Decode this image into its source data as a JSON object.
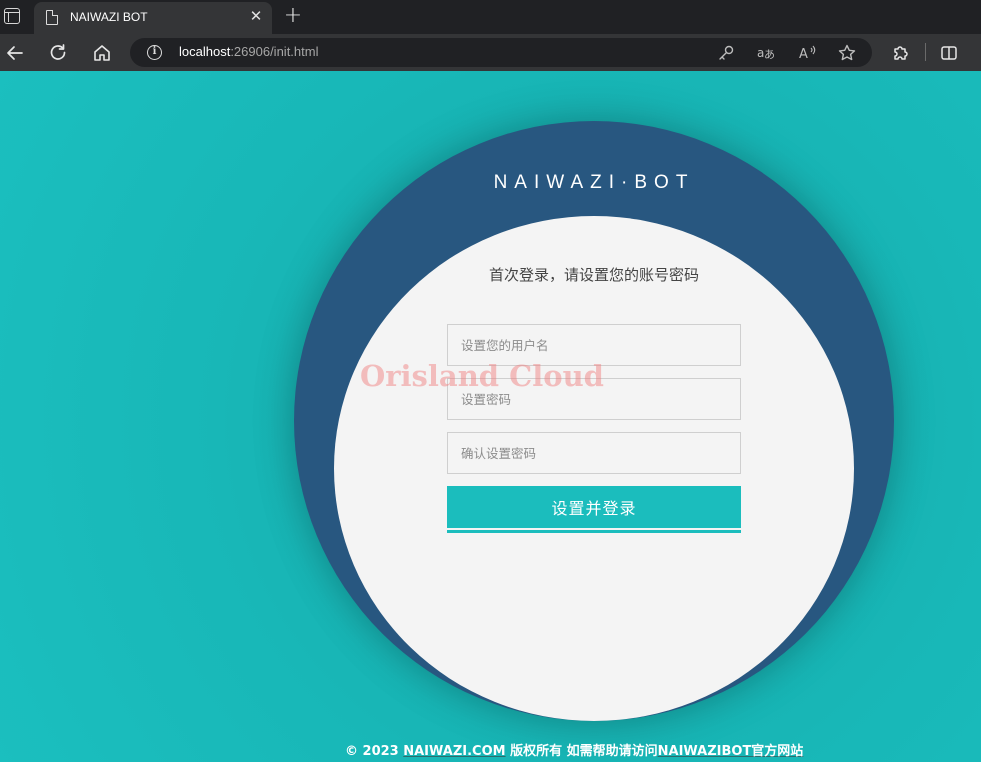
{
  "browser": {
    "tab_title": "NAIWAZI BOT",
    "tab_close": "✕",
    "new_tab": "+",
    "url_host": "localhost",
    "url_rest": ":26906/init.html"
  },
  "page": {
    "brand": "NAIWAZI·BOT",
    "form_title": "首次登录，请设置您的账号密码",
    "username_placeholder": "设置您的用户名",
    "password_placeholder": "设置密码",
    "confirm_placeholder": "确认设置密码",
    "submit_label": "设置并登录",
    "watermark": "Orisland Cloud"
  },
  "footer": {
    "copyright": "© 2023 ",
    "site_link": "NAIWAZI.COM",
    "middle": " 版权所有 如需帮助请访问",
    "help_link": "NAIWAZIBOT官方网站"
  },
  "colors": {
    "background": "#1bbdbd",
    "outer_circle": "#285780",
    "inner_circle": "#f4f4f4",
    "button": "#1bbdbd"
  },
  "icons": [
    "window-icon",
    "page-icon",
    "close-icon",
    "plus-icon",
    "back-icon",
    "refresh-icon",
    "home-icon",
    "info-icon",
    "key-icon",
    "translate-icon",
    "read-aloud-icon",
    "favorite-icon",
    "extensions-icon",
    "split-screen-icon"
  ]
}
